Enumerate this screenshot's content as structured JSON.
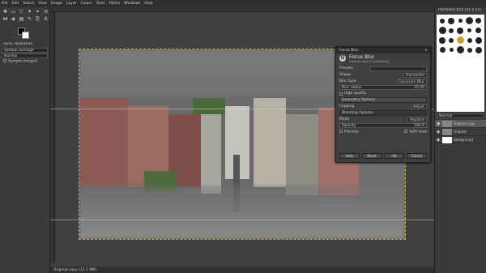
{
  "menubar": {
    "items": [
      "File",
      "Edit",
      "Select",
      "View",
      "Image",
      "Layer",
      "Colors",
      "Tools",
      "Filters",
      "Windows",
      "Help"
    ]
  },
  "tool_options": {
    "title": "GEGL Operation",
    "rows": [
      "Sample average",
      "Normal",
      "Sample merged"
    ]
  },
  "dialog": {
    "title": "Focus Blur",
    "heading": "Focus Blur",
    "subheading": "Original copy-01 ([Untitled])",
    "presets_label": "Presets:",
    "shape_label": "Shape",
    "shape_value": "Horizontal",
    "blur_type_label": "Blur type",
    "blur_type_value": "Gaussian Blur",
    "blur_radius_label": "Blur radius",
    "blur_radius_value": "25.00",
    "high_quality_label": "High quality",
    "geometry_label": "Geometry Options",
    "clipping_label": "Clipping",
    "clipping_value": "Adjust",
    "blending_label": "Blending Options",
    "mode_label": "Mode",
    "mode_value": "Replace",
    "opacity_label": "Opacity",
    "opacity_value": "100.0",
    "preview_label": "Preview",
    "split_label": "Split view",
    "buttons": [
      "Help",
      "Reset",
      "OK",
      "Cancel"
    ]
  },
  "layers": {
    "mode": "Normal",
    "items": [
      {
        "name": "Original copy"
      },
      {
        "name": "Original"
      },
      {
        "name": "Background"
      }
    ]
  },
  "brushes": {
    "title": "Hardness 025 (51 x 51)"
  },
  "status": {
    "layer": "Original copy (11.1 MB)"
  }
}
